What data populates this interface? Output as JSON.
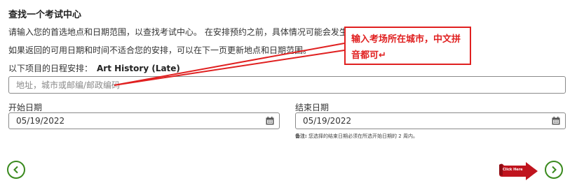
{
  "heading": "查找一个考试中心",
  "intro": "请输入您的首选地点和日期范围，以查找考试中心。 在安排预约之前，具体情况可能会发生变化。",
  "intro2": "如果返回的可用日期和时间不适合您的安排，可以在下一页更新地点和日期范围。",
  "schedule_label": "以下项目的日程安排：",
  "course": "Art History (Late)",
  "address_placeholder": "地址，城市或邮编/邮政编码",
  "start": {
    "label": "开始日期",
    "value": "05/19/2022"
  },
  "end": {
    "label": "结束日期",
    "value": "05/19/2022"
  },
  "note": {
    "prefix": "备注:",
    "text": " 您选择的结束日期必须在所选开始日期的 2 周内。"
  },
  "callout": "输入考场所在城市，中文拼音都可↵",
  "click_here": "Click Here",
  "icons": {
    "calendar": "calendar-icon",
    "back": "chevron-left-icon",
    "next": "chevron-right-icon"
  },
  "colors": {
    "accent_green": "#3a8a1e",
    "annotation_red": "#e02020"
  }
}
